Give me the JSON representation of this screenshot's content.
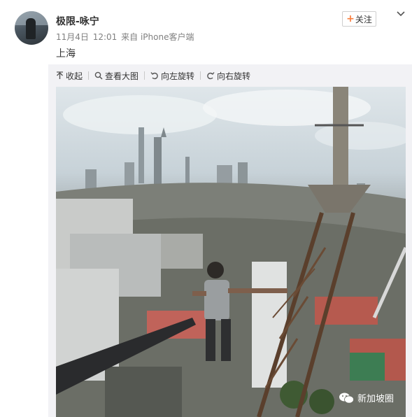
{
  "post": {
    "username": "极限-咏宁",
    "date": "11月4日",
    "time": "12:01",
    "source": "来自 iPhone客户端",
    "text": "上海"
  },
  "actions": {
    "follow_label": "关注"
  },
  "toolbar": {
    "collapse_label": "收起",
    "view_large_label": "查看大图",
    "rotate_left_label": "向左旋转",
    "rotate_right_label": "向右旋转"
  },
  "watermark": {
    "label": "新加坡圈"
  },
  "colors": {
    "follow_plus": "#fa7d3c",
    "media_background": "#f2f2f5",
    "meta_text": "#808080"
  },
  "icons": [
    "arrow-up-icon",
    "search-icon",
    "rotate-left-icon",
    "rotate-right-icon",
    "chevron-down-icon",
    "wechat-icon"
  ]
}
